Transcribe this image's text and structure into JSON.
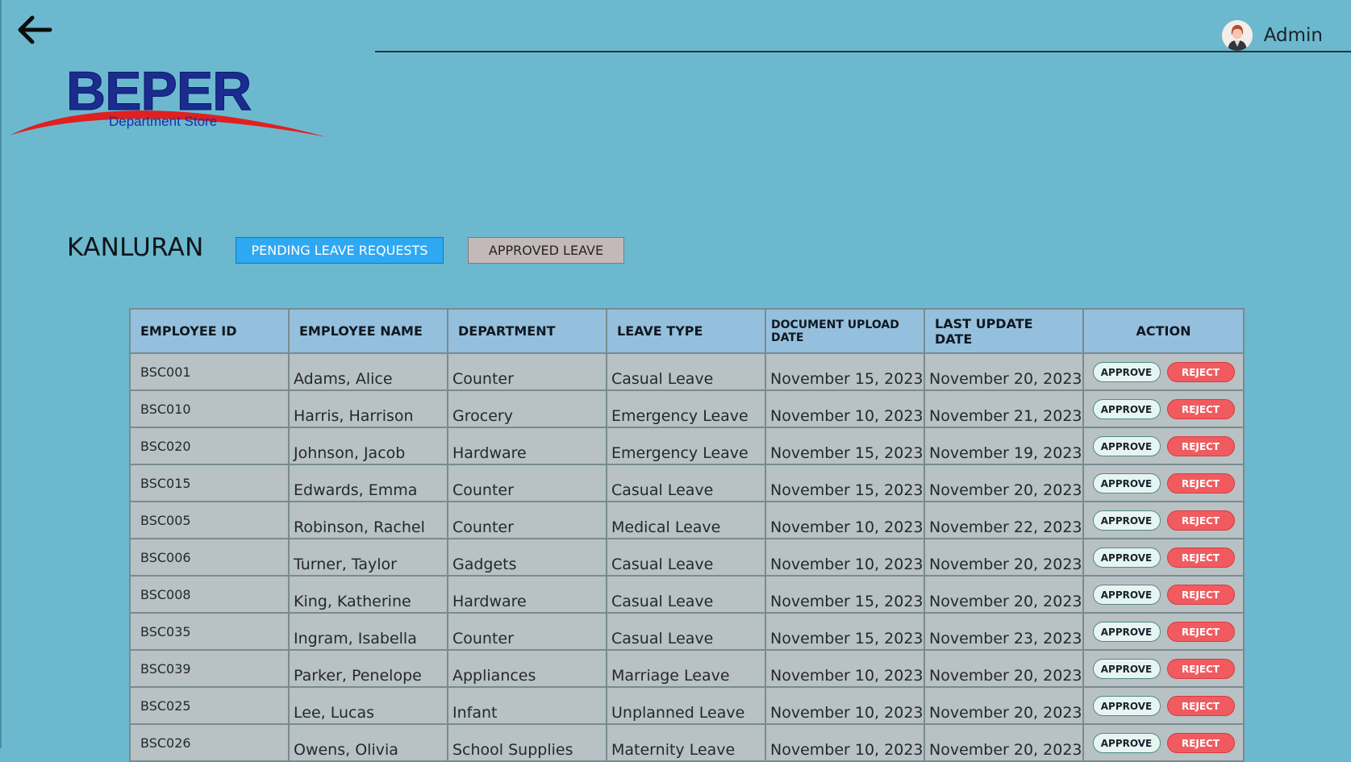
{
  "header": {
    "user_name": "Admin",
    "avatar_icon": "user-avatar-icon",
    "back_icon": "back-arrow-icon"
  },
  "logo": {
    "brand": "BEPER",
    "subtitle": "Department Store",
    "brand_color": "#1b2b8e",
    "swoosh_color": "#e0201f"
  },
  "branch": {
    "title": "KANLURAN"
  },
  "tabs": {
    "pending": "PENDING LEAVE REQUESTS",
    "approved": "APPROVED LEAVE"
  },
  "table": {
    "headers": {
      "employee_id": "EMPLOYEE ID",
      "employee_name": "EMPLOYEE NAME",
      "department": "DEPARTMENT",
      "leave_type": "LEAVE TYPE",
      "document_upload_date": "DOCUMENT UPLOAD DATE",
      "last_update_date": "LAST UPDATE DATE",
      "action": "ACTION"
    },
    "approve_label": "APPROVE",
    "reject_label": "REJECT",
    "rows": [
      {
        "id": "BSC001",
        "name": "Adams, Alice",
        "department": "Counter",
        "leave_type": "Casual Leave",
        "upload_date": "November 15, 2023",
        "last_update": "November 20, 2023"
      },
      {
        "id": "BSC010",
        "name": "Harris, Harrison",
        "department": "Grocery",
        "leave_type": "Emergency Leave",
        "upload_date": "November 10, 2023",
        "last_update": "November 21, 2023"
      },
      {
        "id": "BSC020",
        "name": "Johnson, Jacob",
        "department": "Hardware",
        "leave_type": "Emergency Leave",
        "upload_date": "November 15, 2023",
        "last_update": "November 19, 2023"
      },
      {
        "id": "BSC015",
        "name": "Edwards, Emma",
        "department": "Counter",
        "leave_type": "Casual Leave",
        "upload_date": "November 15, 2023",
        "last_update": "November 20, 2023"
      },
      {
        "id": "BSC005",
        "name": "Robinson, Rachel",
        "department": "Counter",
        "leave_type": "Medical Leave",
        "upload_date": "November 10, 2023",
        "last_update": "November 22, 2023"
      },
      {
        "id": "BSC006",
        "name": "Turner, Taylor",
        "department": "Gadgets",
        "leave_type": "Casual Leave",
        "upload_date": "November 10, 2023",
        "last_update": "November 20, 2023"
      },
      {
        "id": "BSC008",
        "name": "King, Katherine",
        "department": "Hardware",
        "leave_type": "Casual Leave",
        "upload_date": "November 15, 2023",
        "last_update": "November 20, 2023"
      },
      {
        "id": "BSC035",
        "name": "Ingram, Isabella",
        "department": "Counter",
        "leave_type": "Casual Leave",
        "upload_date": "November 15, 2023",
        "last_update": "November 23, 2023"
      },
      {
        "id": "BSC039",
        "name": "Parker, Penelope",
        "department": "Appliances",
        "leave_type": "Marriage Leave",
        "upload_date": "November 10, 2023",
        "last_update": "November 20, 2023"
      },
      {
        "id": "BSC025",
        "name": "Lee, Lucas",
        "department": "Infant",
        "leave_type": "Unplanned Leave",
        "upload_date": "November 10, 2023",
        "last_update": "November 20, 2023"
      },
      {
        "id": "BSC026",
        "name": "Owens, Olivia",
        "department": "School Supplies",
        "leave_type": "Maternity Leave",
        "upload_date": "November 10, 2023",
        "last_update": "November 20, 2023"
      }
    ]
  }
}
